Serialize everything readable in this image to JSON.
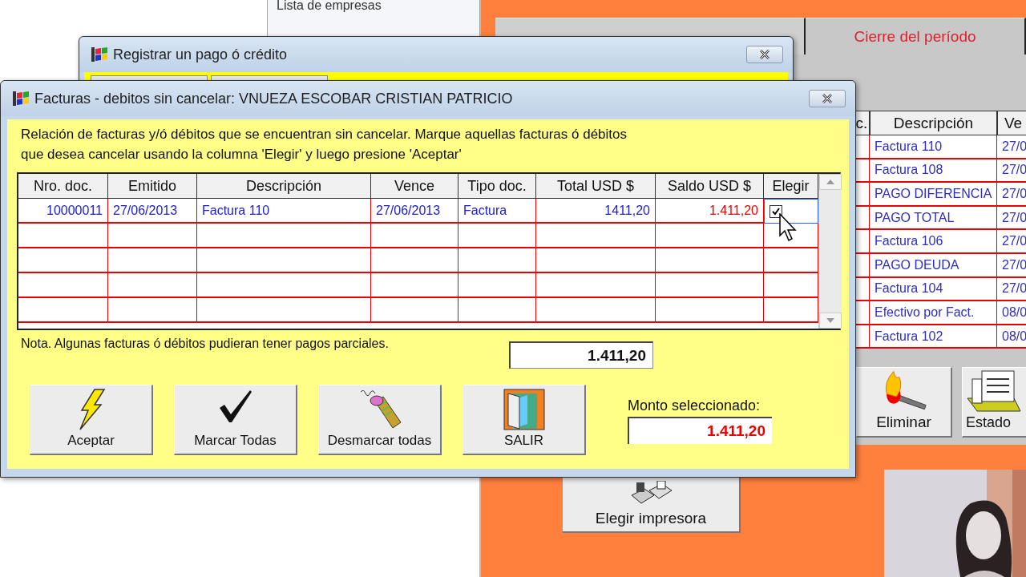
{
  "background_window": {
    "list_label": "Lista de empresas"
  },
  "main_panel": {
    "tabs": [
      {
        "selected": true
      },
      {
        "label": "Cierre del período",
        "selected": false
      }
    ],
    "table": {
      "columns": [
        "c.",
        "Descripción",
        "Ve"
      ],
      "rows": [
        {
          "description": "Factura 110",
          "date": "27/0"
        },
        {
          "description": "Factura 108",
          "date": "27/0"
        },
        {
          "description": "PAGO DIFERENCIA",
          "date": "27/0"
        },
        {
          "description": "PAGO TOTAL",
          "date": "27/0"
        },
        {
          "description": "Factura 106",
          "date": "27/0"
        },
        {
          "description": "PAGO DEUDA",
          "date": "27/0"
        },
        {
          "description": "Factura 104",
          "date": "27/0"
        },
        {
          "description": "Efectivo por Fact.",
          "date": "08/0"
        },
        {
          "description": "Factura 102",
          "date": "08/0"
        }
      ]
    },
    "buttons": [
      {
        "label": "Eliminar",
        "kind": "delete"
      },
      {
        "label": "Estado",
        "kind": "status"
      }
    ],
    "printer_button": "Elegir impresora"
  },
  "payment_dialog": {
    "title": "Registrar un pago ó crédito"
  },
  "invoices_dialog": {
    "title": "Facturas - debitos sin cancelar: VNUEZA ESCOBAR CRISTIAN PATRICIO",
    "instructions": "Relación de facturas y/ó débitos que se encuentran sin cancelar.  Marque aquellas facturas  ó débitos\nque  desea  cancelar  usando la columna 'Elegir' y luego presione 'Aceptar'",
    "table": {
      "columns": [
        "Nro. doc.",
        "Emitido",
        "Descripción",
        "Vence",
        "Tipo doc.",
        "Total  USD $",
        "Saldo USD $",
        "Elegir"
      ],
      "rows": [
        {
          "cells": [
            "10000011",
            "27/06/2013",
            "Factura 110",
            "27/06/2013",
            "Factura",
            "1411,20",
            "1.411,20"
          ],
          "checked": true
        }
      ]
    },
    "note": "Nota. Algunas facturas ó débitos pudieran tener pagos parciales.",
    "total": "1.411,20",
    "buttons": [
      {
        "label": "Aceptar",
        "kind": "accept"
      },
      {
        "label": "Marcar Todas",
        "kind": "check_all"
      },
      {
        "label": "Desmarcar todas",
        "kind": "uncheck_all"
      },
      {
        "label": "SALIR",
        "kind": "exit"
      }
    ],
    "selected_amount_label": "Monto seleccionado:",
    "selected_amount": "1.411,20"
  }
}
